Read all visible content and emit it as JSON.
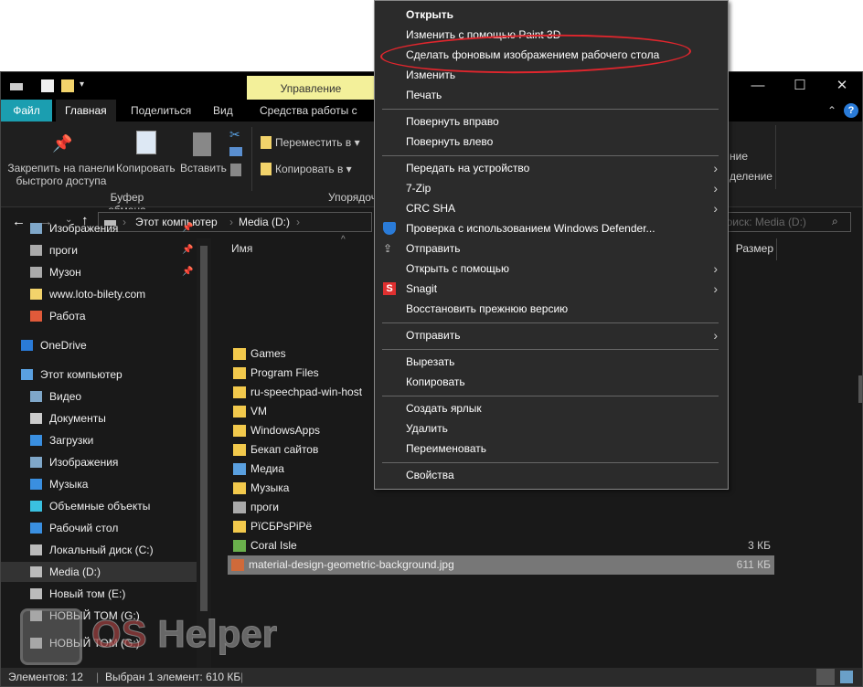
{
  "titlebar": {
    "contextual_tab": "Управление",
    "minimize": "—",
    "maximize": "☐",
    "close": "✕"
  },
  "tabs": [
    "Файл",
    "Главная",
    "Поделиться",
    "Вид",
    "Средства работы с рисунками"
  ],
  "ribbon": {
    "pin": "Закрепить на панели быстрого доступа",
    "copy": "Копировать",
    "paste": "Вставить",
    "clipboard_group": "Буфер обмена",
    "move_to": "Переместить в",
    "copy_to": "Копировать в",
    "organize_group": "Упорядочить",
    "right_1": "ние",
    "right_2": "деление"
  },
  "address": {
    "path": [
      "Этот компьютер",
      "Media (D:)"
    ],
    "search_placeholder": "Поиск: Media (D:)"
  },
  "columns": {
    "name": "Имя",
    "size": "Размер"
  },
  "sidebar": [
    "Изображения",
    "проги",
    "Музон",
    "www.loto-bilety.com",
    "Работа",
    "OneDrive",
    "Этот компьютер",
    "Видео",
    "Документы",
    "Загрузки",
    "Изображения",
    "Музыка",
    "Объемные объекты",
    "Рабочий стол",
    "Локальный диск (C:)",
    "Media (D:)",
    "Новый том (E:)",
    "НОВЫЙ ТОМ (G:)",
    "НОВЫЙ ТОМ (G:)"
  ],
  "files": [
    {
      "name": "Games",
      "size": ""
    },
    {
      "name": "Program Files",
      "size": ""
    },
    {
      "name": "ru-speechpad-win-host",
      "size": ""
    },
    {
      "name": "VM",
      "size": ""
    },
    {
      "name": "WindowsApps",
      "size": ""
    },
    {
      "name": "Бекап сайтов",
      "size": ""
    },
    {
      "name": "Медиа",
      "size": ""
    },
    {
      "name": "Музыка",
      "size": ""
    },
    {
      "name": "проги",
      "size": ""
    },
    {
      "name": "PïCБPsPiPë",
      "size": ""
    },
    {
      "name": "Coral Isle",
      "size": "3 КБ"
    },
    {
      "name": "material-design-geometric-background.jpg",
      "size": "611 КБ"
    }
  ],
  "status": {
    "count": "Элементов: 12",
    "selected": "Выбран 1 элемент: 610 КБ"
  },
  "menu": [
    {
      "label": "Открыть",
      "bold": true
    },
    {
      "label": "Изменить с помощью Paint 3D"
    },
    {
      "label": "Сделать фоновым изображением рабочего стола"
    },
    {
      "label": "Изменить"
    },
    {
      "label": "Печать"
    },
    {
      "label": "Повернуть вправо"
    },
    {
      "label": "Повернуть влево"
    },
    {
      "label": "Передать на устройство",
      "sub": true
    },
    {
      "label": "7-Zip",
      "sub": true
    },
    {
      "label": "CRC SHA",
      "sub": true
    },
    {
      "label": "Проверка с использованием Windows Defender..."
    },
    {
      "label": "Отправить"
    },
    {
      "label": "Открыть с помощью",
      "sub": true
    },
    {
      "label": "Snagit",
      "sub": true
    },
    {
      "label": "Восстановить прежнюю версию"
    },
    {
      "label": "Отправить",
      "sub": true
    },
    {
      "label": "Вырезать"
    },
    {
      "label": "Копировать"
    },
    {
      "label": "Создать ярлык"
    },
    {
      "label": "Удалить"
    },
    {
      "label": "Переименовать"
    },
    {
      "label": "Свойства"
    }
  ],
  "watermark": "OS Helper",
  "colors": {
    "highlight": "#e0262d",
    "accent": "#1b9eb0",
    "manage": "#f3f09a"
  }
}
